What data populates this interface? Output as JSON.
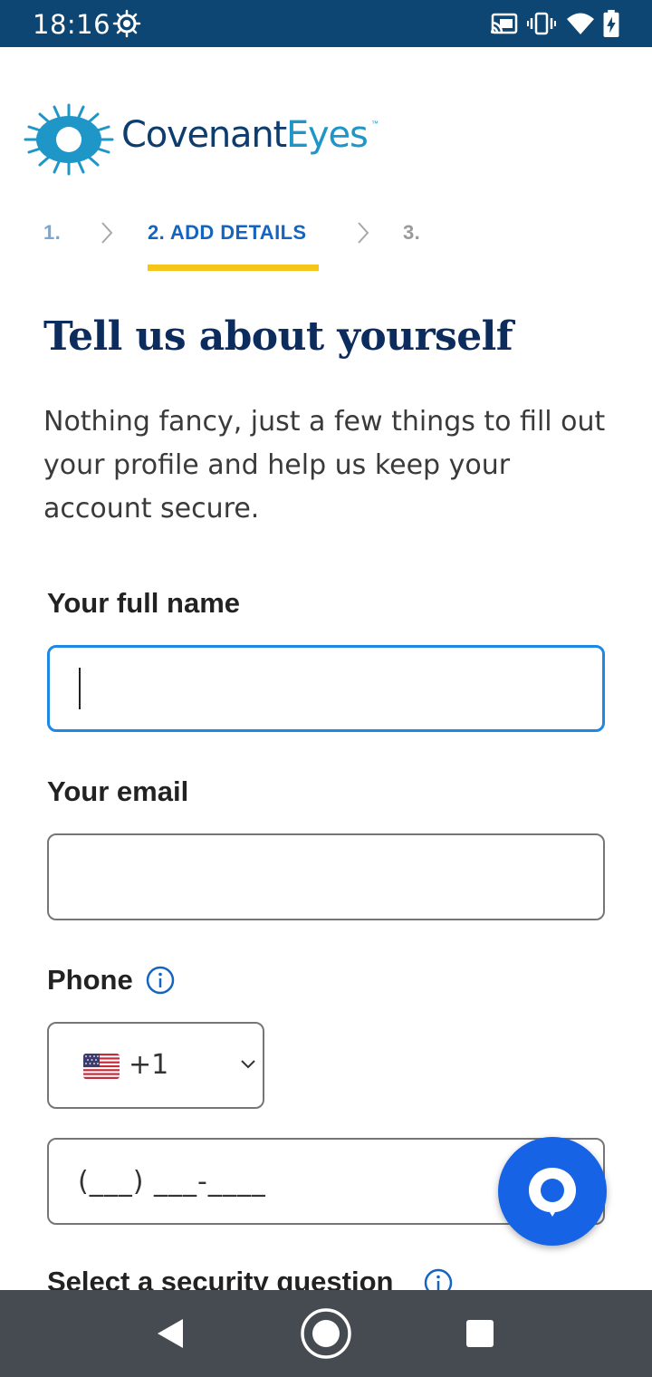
{
  "status_bar": {
    "time": "18:16",
    "background": "#0d4672",
    "left_icons": [
      "radar-notification-icon"
    ],
    "right_icons": [
      "cast-icon",
      "vibrate-icon",
      "wifi-icon",
      "battery-charging-icon"
    ]
  },
  "brand": {
    "name_part1": "Covenant",
    "name_part2": "Eyes",
    "trademark": "™",
    "colors": {
      "dark": "#0d3d6e",
      "light": "#1e96c8"
    }
  },
  "stepper": {
    "steps": [
      {
        "label": "1.",
        "state": "completed"
      },
      {
        "label": "2.  ADD DETAILS",
        "state": "active"
      },
      {
        "label": "3.",
        "state": "upcoming"
      }
    ],
    "active_underline_color": "#f5c518"
  },
  "page": {
    "title": "Tell us about yourself",
    "description": "Nothing fancy, just a few things to fill out your profile and help us keep your account secure."
  },
  "form": {
    "full_name": {
      "label": "Your full name",
      "value": "",
      "focused": true
    },
    "email": {
      "label": "Your email",
      "value": ""
    },
    "phone": {
      "label": "Phone",
      "country_code": "+1",
      "country_flag": "us-flag",
      "mask_placeholder": "(___) ___-____"
    },
    "security_question": {
      "label": "Select a security question"
    }
  },
  "chat_button": {
    "color": "#1663e6",
    "icon": "chat-bubble-icon"
  },
  "nav_bar": {
    "buttons": [
      "back-icon",
      "home-icon",
      "recents-icon"
    ]
  }
}
